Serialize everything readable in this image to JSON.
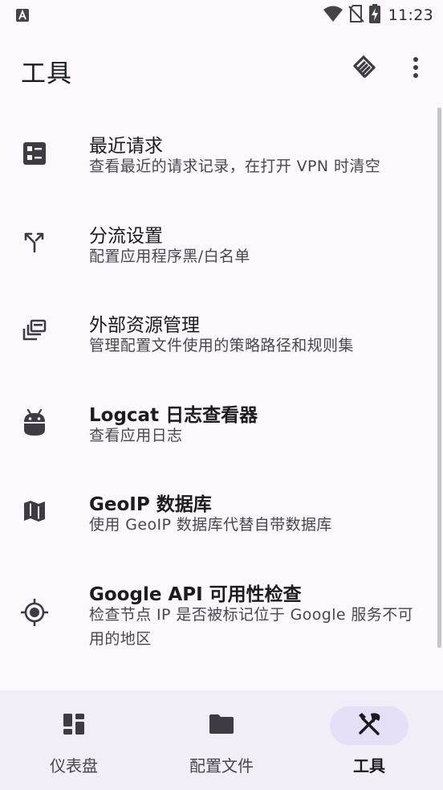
{
  "status_bar": {
    "time": "11:23",
    "icons": [
      "android-notification-icon",
      "wifi-icon",
      "no-sim-icon",
      "battery-charging-icon"
    ]
  },
  "app_bar": {
    "title": "工具",
    "actions": [
      "sponsor-icon",
      "more-vert-icon"
    ]
  },
  "tools": [
    {
      "icon": "dashboard-list-icon",
      "title": "最近请求",
      "description": "查看最近的请求记录，在打开 VPN 时清空"
    },
    {
      "icon": "route-split-icon",
      "title": "分流设置",
      "description": "配置应用程序黑/白名单"
    },
    {
      "icon": "external-resources-icon",
      "title": "外部资源管理",
      "description": "管理配置文件使用的策略路径和规则集"
    },
    {
      "icon": "android-logcat-icon",
      "title": "Logcat 日志查看器",
      "description": "查看应用日志"
    },
    {
      "icon": "map-icon",
      "title": "GeoIP 数据库",
      "description": "使用 GeoIP 数据库代替自带数据库"
    },
    {
      "icon": "gps-target-icon",
      "title": "Google API 可用性检查",
      "description": "检查节点 IP 是否被标记位于 Google 服务不可用的地区"
    }
  ],
  "bottom_nav": {
    "items": [
      {
        "icon": "dashboard-icon",
        "label": "仪表盘",
        "active": false
      },
      {
        "icon": "folder-icon",
        "label": "配置文件",
        "active": false
      },
      {
        "icon": "tools-icon",
        "label": "工具",
        "active": true
      }
    ]
  },
  "colors": {
    "background": "#fdf8fd",
    "bottom_nav_bg": "#f3edf7",
    "active_pill": "#e7def8",
    "icon": "#3f3b44"
  }
}
